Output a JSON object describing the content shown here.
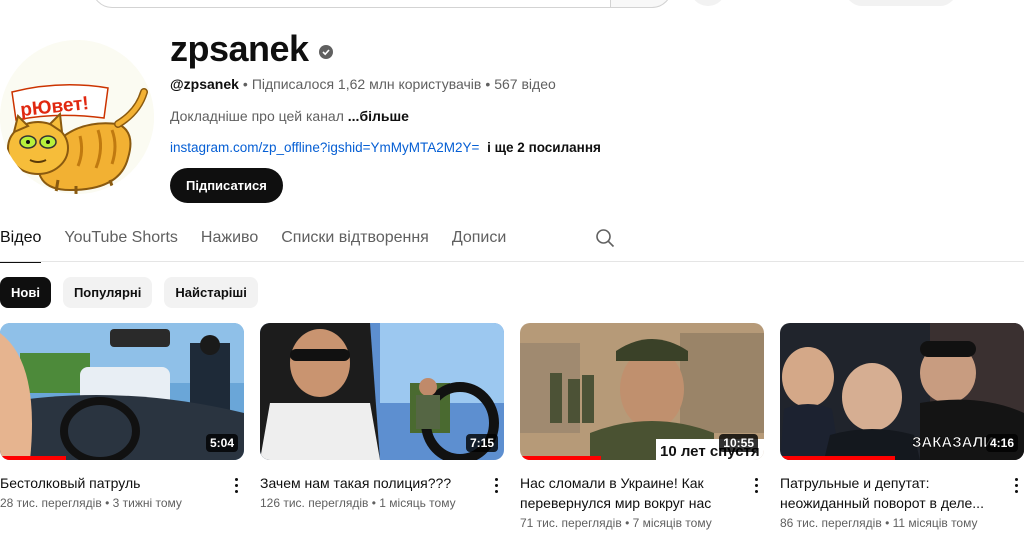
{
  "channel": {
    "name": "zpsanek",
    "handle": "@zpsanek",
    "subscribers": "Підписалося 1,62 млн користувачів",
    "video_count": "567 відео",
    "about": "Докладніше про цей канал",
    "about_more": "...більше",
    "link": "instagram.com/zp_offline?igshid=YmMyMTA2M2Y=",
    "more_links": "і ще 2 посилання",
    "subscribe_label": "Підписатися",
    "avatar_text": "рЮвет!"
  },
  "tabs": [
    {
      "label": "Відео",
      "active": true
    },
    {
      "label": "YouTube Shorts",
      "active": false
    },
    {
      "label": "Наживо",
      "active": false
    },
    {
      "label": "Списки відтворення",
      "active": false
    },
    {
      "label": "Дописи",
      "active": false
    }
  ],
  "chips": [
    {
      "label": "Нові",
      "active": true
    },
    {
      "label": "Популярні",
      "active": false
    },
    {
      "label": "Найстаріші",
      "active": false
    }
  ],
  "videos": [
    {
      "title": "Бестолковый патруль",
      "views": "28 тис. переглядів",
      "age": "3 тижні тому",
      "duration": "5:04",
      "watched_fraction": 0.27
    },
    {
      "title": "Зачем нам такая полиция???",
      "views": "126 тис. переглядів",
      "age": "1 місяць тому",
      "duration": "7:15",
      "watched_fraction": 0
    },
    {
      "title": "Нас сломали в Украине! Как перевернулся мир вокруг нас",
      "views": "71 тис. переглядів",
      "age": "7 місяців тому",
      "duration": "10:55",
      "watched_fraction": 0.33,
      "overlay_text": "10 лет спустя"
    },
    {
      "title": "Патрульные и депутат: неожиданный поворот в деле...",
      "views": "86 тис. переглядів",
      "age": "11 місяців тому",
      "duration": "4:16",
      "watched_fraction": 0.47,
      "overlay_text": "ЗАКАЗАЛИ"
    }
  ],
  "colors": {
    "accent": "#0f0f0f",
    "link": "#065fd4",
    "progress": "#ff0000",
    "secondary_text": "#606060"
  }
}
